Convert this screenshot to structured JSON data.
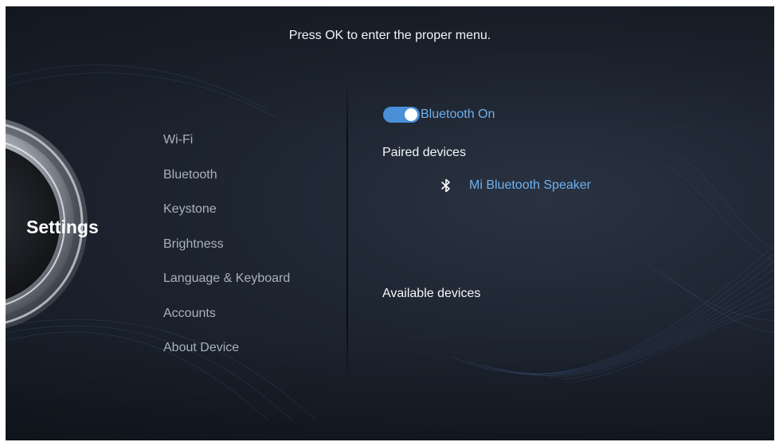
{
  "hint": "Press OK to enter the proper menu.",
  "dial_label": "Settings",
  "menu": {
    "items": [
      "Wi-Fi",
      "Bluetooth",
      "Keystone",
      "Brightness",
      "Language & Keyboard",
      "Accounts",
      "About Device"
    ]
  },
  "bluetooth": {
    "toggle_label": "Bluetooth On",
    "toggle_on": true,
    "paired_title": "Paired devices",
    "paired_devices": [
      "Mi Bluetooth Speaker"
    ],
    "available_title": "Available devices"
  },
  "colors": {
    "accent": "#4a90d9",
    "accent_text": "#6fb1ef",
    "menu_text": "#a9b1bd"
  },
  "icons": [
    "bluetooth-icon",
    "settings-dial-icon"
  ]
}
